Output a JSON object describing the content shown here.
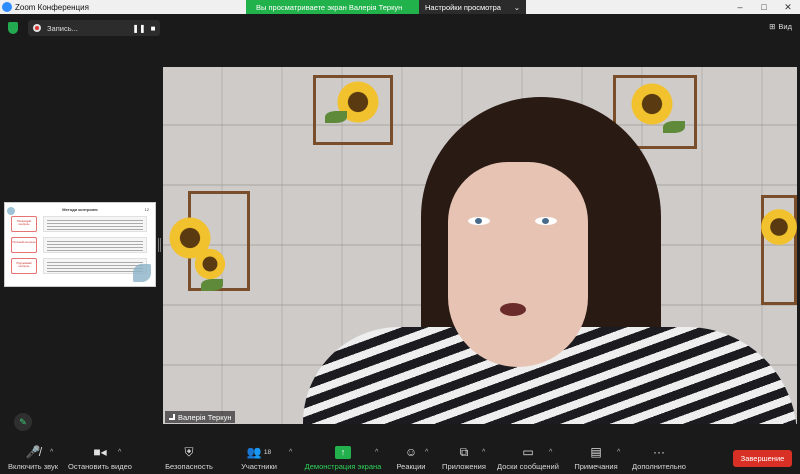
{
  "window": {
    "title": "Zoom Конференция",
    "share_banner": "Вы просматриваете экран Валерія Теркун",
    "view_options": "Настройки просмотра",
    "controls": [
      "–",
      "□",
      "✕"
    ]
  },
  "topbar": {
    "recording_label": "Запись...",
    "view_label": "Вид"
  },
  "thumbnail": {
    "slide_title": "Методи контролю",
    "slide_number": "12",
    "rows": [
      {
        "tag": "Попередній контроль"
      },
      {
        "tag": "Поточний контроль"
      },
      {
        "tag": "Підсумковий контроль"
      }
    ]
  },
  "video": {
    "participant_name": "Валерія Теркун"
  },
  "toolbar": {
    "items": [
      {
        "id": "mute",
        "label": "Включить звук",
        "icon": "mic-muted-icon"
      },
      {
        "id": "video",
        "label": "Остановить видео",
        "icon": "video-camera-icon"
      },
      {
        "id": "security",
        "label": "Безопасность",
        "icon": "shield-icon"
      },
      {
        "id": "participants",
        "label": "Участники",
        "icon": "people-icon",
        "count": "18"
      },
      {
        "id": "share",
        "label": "Демонстрация экрана",
        "icon": "share-screen-icon"
      },
      {
        "id": "reactions",
        "label": "Реакции",
        "icon": "smile-icon"
      },
      {
        "id": "apps",
        "label": "Приложения",
        "icon": "apps-icon"
      },
      {
        "id": "whiteboards",
        "label": "Доски сообщений",
        "icon": "whiteboard-icon"
      },
      {
        "id": "notes",
        "label": "Примечания",
        "icon": "notes-icon"
      },
      {
        "id": "more",
        "label": "Дополнительно",
        "icon": "more-icon"
      }
    ],
    "end_label": "Завершение"
  },
  "colors": {
    "share_green": "#22b24c",
    "end_red": "#d93025",
    "security_green": "#23a94f"
  }
}
